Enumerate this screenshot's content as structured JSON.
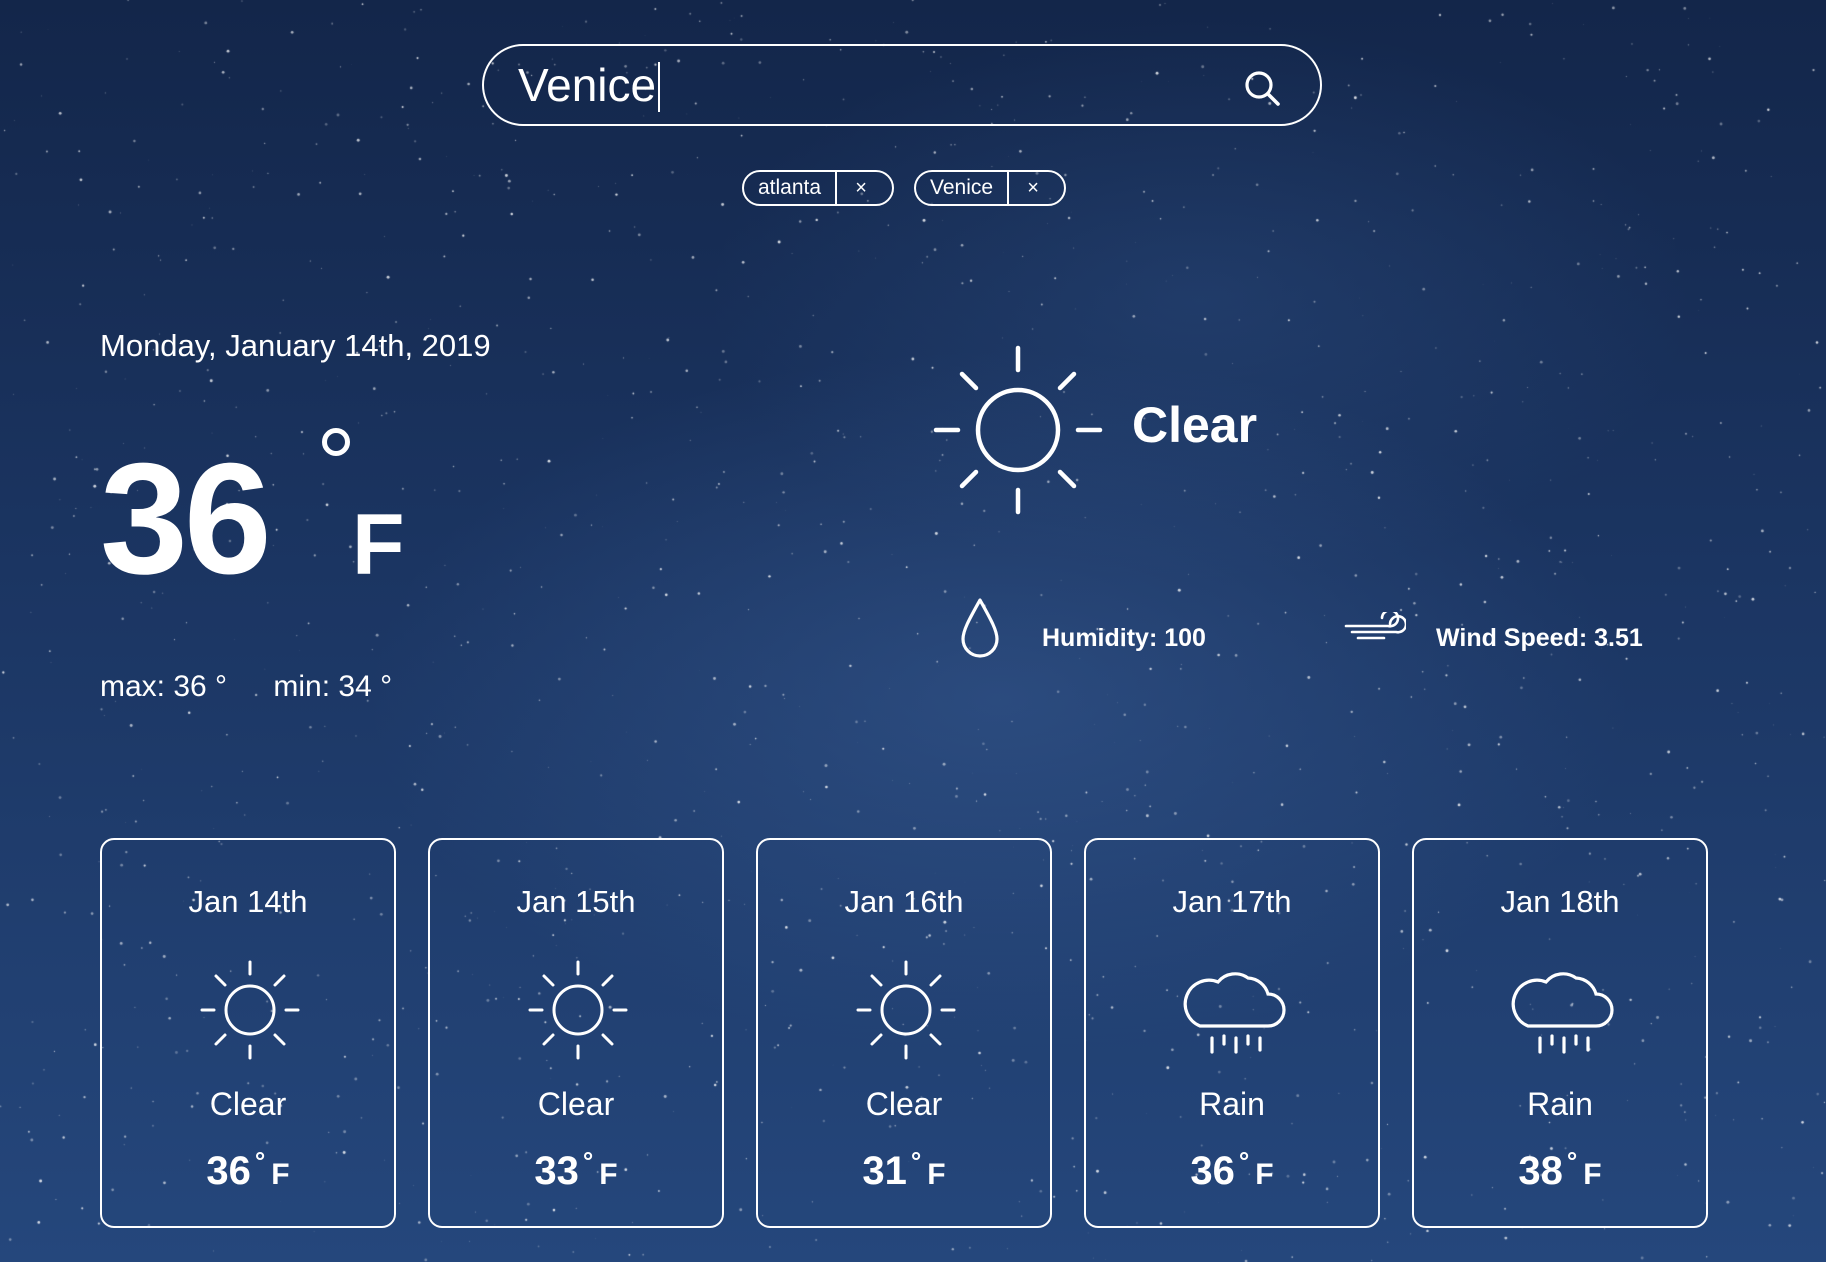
{
  "search": {
    "value": "Venice",
    "placeholder": ""
  },
  "recent": [
    {
      "label": "atlanta",
      "remove": "×"
    },
    {
      "label": "Venice",
      "remove": "×"
    }
  ],
  "current": {
    "date": "Monday, January 14th, 2019",
    "temp": "36",
    "unit": "F",
    "max": "max: 36 °",
    "min": "min: 34 °",
    "condition": "Clear",
    "condition_icon": "sun-icon",
    "humidity": "Humidity: 100",
    "wind": "Wind Speed: 3.51"
  },
  "forecast": [
    {
      "date": "Jan 14th",
      "icon": "sun-icon",
      "condition": "Clear",
      "temp": "36",
      "deg": "°",
      "unit": "F"
    },
    {
      "date": "Jan 15th",
      "icon": "sun-icon",
      "condition": "Clear",
      "temp": "33",
      "deg": "°",
      "unit": "F"
    },
    {
      "date": "Jan 16th",
      "icon": "sun-icon",
      "condition": "Clear",
      "temp": "31",
      "deg": "°",
      "unit": "F"
    },
    {
      "date": "Jan 17th",
      "icon": "rain-cloud-icon",
      "condition": "Rain",
      "temp": "36",
      "deg": "°",
      "unit": "F"
    },
    {
      "date": "Jan 18th",
      "icon": "rain-cloud-icon",
      "condition": "Rain",
      "temp": "38",
      "deg": "°",
      "unit": "F"
    }
  ]
}
